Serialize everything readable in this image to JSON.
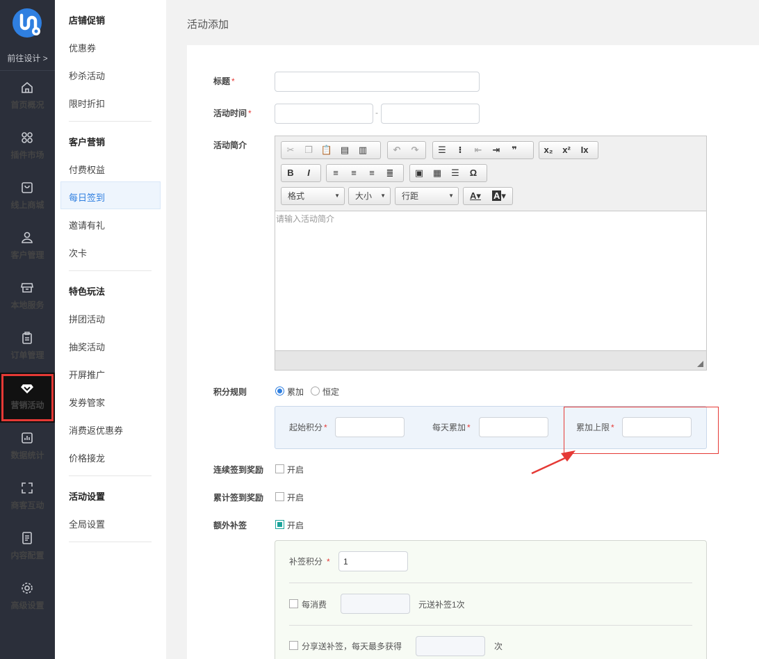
{
  "nav": {
    "goto_design": "前往设计 >",
    "items": [
      {
        "label": "首页概况",
        "icon": "home-icon"
      },
      {
        "label": "插件市场",
        "icon": "apps-icon"
      },
      {
        "label": "线上商城",
        "icon": "bag-icon"
      },
      {
        "label": "客户管理",
        "icon": "user-icon"
      },
      {
        "label": "本地服务",
        "icon": "store-icon"
      },
      {
        "label": "订单管理",
        "icon": "clipboard-icon"
      },
      {
        "label": "营销活动",
        "icon": "diamond-icon",
        "active": true
      },
      {
        "label": "数据统计",
        "icon": "chart-icon"
      },
      {
        "label": "商客互动",
        "icon": "scan-icon"
      },
      {
        "label": "内容配置",
        "icon": "document-icon"
      },
      {
        "label": "高级设置",
        "icon": "gear-icon"
      }
    ]
  },
  "submenu": {
    "groups": [
      {
        "title": "店铺促销",
        "items": [
          "优惠券",
          "秒杀活动",
          "限时折扣"
        ]
      },
      {
        "title": "客户营销",
        "items": [
          "付费权益",
          "每日签到",
          "邀请有礼",
          "次卡"
        ]
      },
      {
        "title": "特色玩法",
        "items": [
          "拼团活动",
          "抽奖活动",
          "开屏推广",
          "发券管家",
          "消费返优惠券",
          "价格接龙"
        ]
      },
      {
        "title": "活动设置",
        "items": [
          "全局设置"
        ]
      }
    ],
    "selected": "每日签到"
  },
  "page_title": "活动添加",
  "form": {
    "title_label": "标题",
    "time_label": "活动时间",
    "time_sep": "-",
    "intro_label": "活动简介",
    "intro_placeholder": "请输入活动简介",
    "editor": {
      "format": "格式",
      "size": "大小",
      "line_height": "行距"
    },
    "points_rule_label": "积分规则",
    "rule_options": [
      "累加",
      "恒定"
    ],
    "rule_selected": "累加",
    "start_points_label": "起始积分",
    "daily_add_label": "每天累加",
    "add_limit_label": "累加上限",
    "consecutive_label": "连续签到奖励",
    "cumulative_label": "累计签到奖励",
    "extra_label": "额外补签",
    "enable_text": "开启",
    "consecutive_on": false,
    "cumulative_on": false,
    "extra_on": true,
    "makeup_points_label": "补签积分",
    "makeup_points_value": "1",
    "per_spend_label": "每消费",
    "per_spend_suffix": "元送补签1次",
    "share_label": "分享送补签，每天最多获得",
    "share_suffix": "次"
  },
  "colors": {
    "nav_bg": "#2b2f3a",
    "accent": "#2f7fe0",
    "highlight": "#e53935",
    "check": "#1aa39a"
  }
}
